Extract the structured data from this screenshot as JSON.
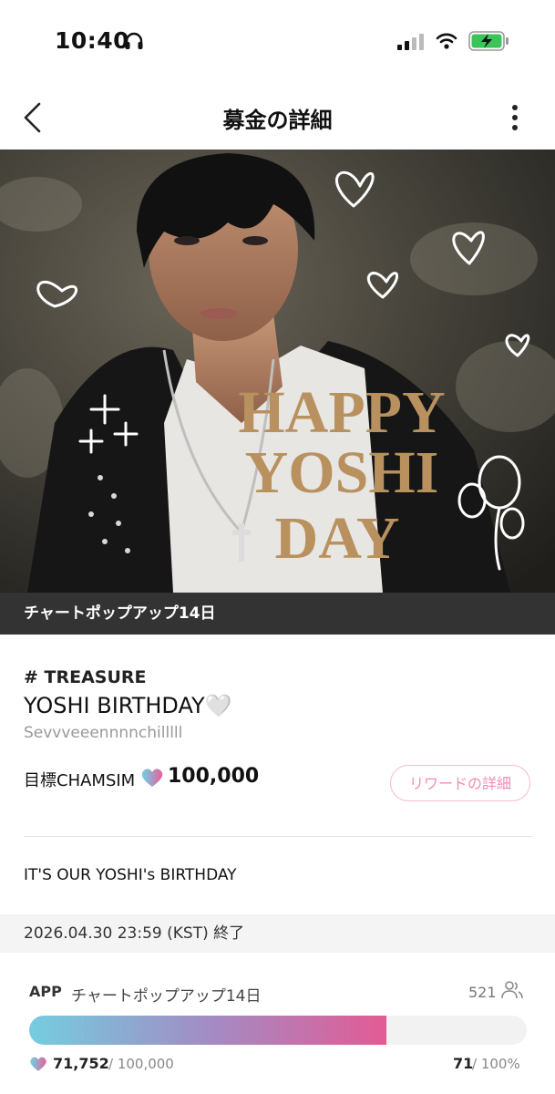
{
  "status_bar": {
    "time": "10:40",
    "icons": [
      "headphones-icon",
      "signal-icon",
      "wifi-icon",
      "battery-charging-icon"
    ]
  },
  "nav": {
    "title": "募金の詳細",
    "back_icon": "chevron-left-icon",
    "more_icon": "vertical-dots-icon"
  },
  "hero": {
    "overlay_text": [
      "HAPPY",
      "YOSHI",
      "DAY"
    ],
    "caption": "チャートポップアップ14日"
  },
  "campaign": {
    "artist": "# TREASURE",
    "title": "YOSHI BIRTHDAY🤍",
    "author": "Sevvveeennnnchilllll",
    "goal_label": "目標CHAMSIM",
    "goal_amount": "100,000",
    "reward_button": "リワードの詳細",
    "description": "IT'S OUR YOSHI's BIRTHDAY",
    "deadline": "2026.04.30 23:59 (KST) 終了"
  },
  "progress": {
    "platform": "APP",
    "chart_name": "チャートポップアップ14日",
    "participants": "521",
    "raised": "71,752",
    "goal": "/ 100,000",
    "count": "71",
    "percent_label": "/ 100%",
    "fill_fraction": 0.71752
  },
  "colors": {
    "accent_pink": "#e35b94",
    "accent_blue": "#74cde0",
    "caption_bg": "#333333"
  }
}
